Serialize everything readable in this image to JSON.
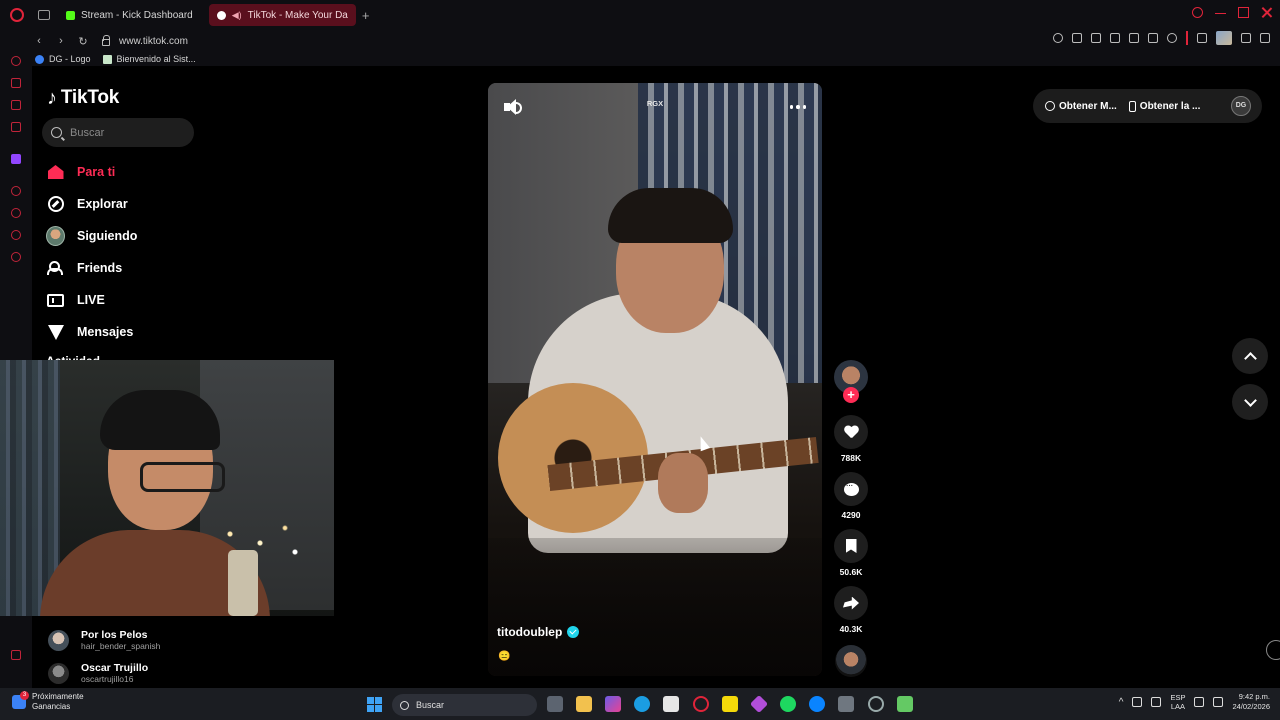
{
  "browser": {
    "tabs": [
      {
        "label": "Stream - Kick Dashboard",
        "active": false
      },
      {
        "label": "TikTok - Make Your Da",
        "active": true
      }
    ],
    "new_tab": "+",
    "url": "www.tiktok.com",
    "bookmarks": [
      "DG - Logo",
      "Bienvenido al Sist..."
    ]
  },
  "tiktok": {
    "logo_text": "TikTok",
    "search_placeholder": "Buscar",
    "nav": [
      {
        "label": "Para ti",
        "icon": "home-icon",
        "active": true
      },
      {
        "label": "Explorar",
        "icon": "compass-icon"
      },
      {
        "label": "Siguiendo",
        "icon": "following-avatar"
      },
      {
        "label": "Friends",
        "icon": "friends-icon"
      },
      {
        "label": "LIVE",
        "icon": "live-icon"
      },
      {
        "label": "Mensajes",
        "icon": "message-icon"
      }
    ],
    "partial_nav": "Actividad",
    "following": [
      {
        "name": "Por los Pelos",
        "handle": "hair_bender_spanish"
      },
      {
        "name": "Oscar Trujillo",
        "handle": "oscartrujillo16"
      }
    ],
    "video": {
      "watermark": "RGX",
      "author": "titodoublep",
      "caption_emoji": "😑"
    },
    "actions": {
      "follow_plus": "+",
      "likes": "788K",
      "comments": "4290",
      "saves": "50.6K",
      "shares": "40.3K"
    },
    "top_right": {
      "get_coins": "Obtener M...",
      "get_app": "Obtener la ...",
      "profile_initials": "DG"
    }
  },
  "taskbar": {
    "weather_badge": "3",
    "weather_line1": "Próximamente",
    "weather_line2": "Ganancias",
    "search": "Buscar",
    "lang_line1": "ESP",
    "lang_line2": "LAA",
    "time": "9:42 p.m.",
    "date": "24/02/2026"
  },
  "colors": {
    "tiktok_red": "#fe2c55",
    "opera_red": "#e0243a",
    "verified": "#20d5ec"
  }
}
